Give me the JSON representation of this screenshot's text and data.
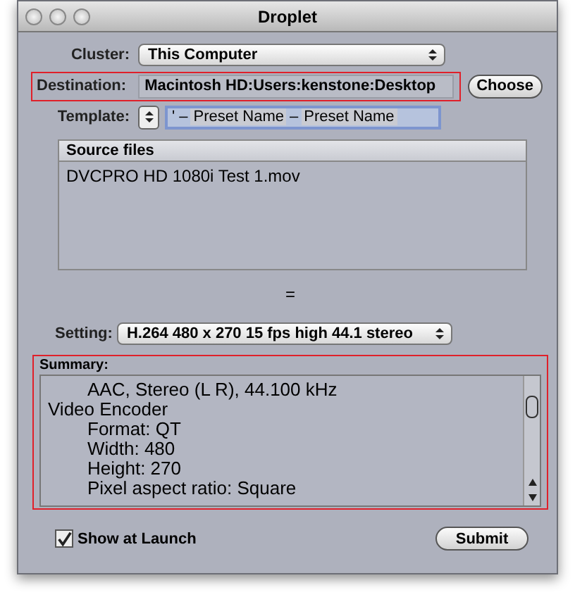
{
  "window": {
    "title": "Droplet"
  },
  "cluster": {
    "label": "Cluster:",
    "value": "This Computer"
  },
  "destination": {
    "label": "Destination:",
    "value": "Macintosh HD:Users:kenstone:Desktop",
    "highlighted": true
  },
  "choose_button": "Choose",
  "template": {
    "label": "Template:",
    "tokens": [
      {
        "kind": "separator",
        "text": "' –"
      },
      {
        "kind": "token",
        "text": "Preset Name"
      },
      {
        "kind": "separator",
        "text": "–"
      },
      {
        "kind": "token",
        "text": "Preset Name"
      }
    ]
  },
  "source_files": {
    "header": "Source files",
    "items": [
      "DVCPRO HD 1080i Test 1.mov"
    ]
  },
  "splitter": "=",
  "setting": {
    "label": "Setting:",
    "value": "H.264 480 x 270 15 fps  high 44.1 stereo"
  },
  "summary": {
    "label": "Summary:",
    "highlighted": true,
    "lines": [
      {
        "text": "AAC, Stereo (L R), 44.100 kHz",
        "indented": true
      },
      {
        "text": "Video Encoder",
        "indented": false
      },
      {
        "text": "Format: QT",
        "indented": true
      },
      {
        "text": "Width: 480",
        "indented": true
      },
      {
        "text": "Height: 270",
        "indented": true
      },
      {
        "text": "Pixel aspect ratio: Square",
        "indented": true
      }
    ]
  },
  "show_at_launch": {
    "label": "Show at Launch",
    "checked": true
  },
  "submit_button": "Submit"
}
